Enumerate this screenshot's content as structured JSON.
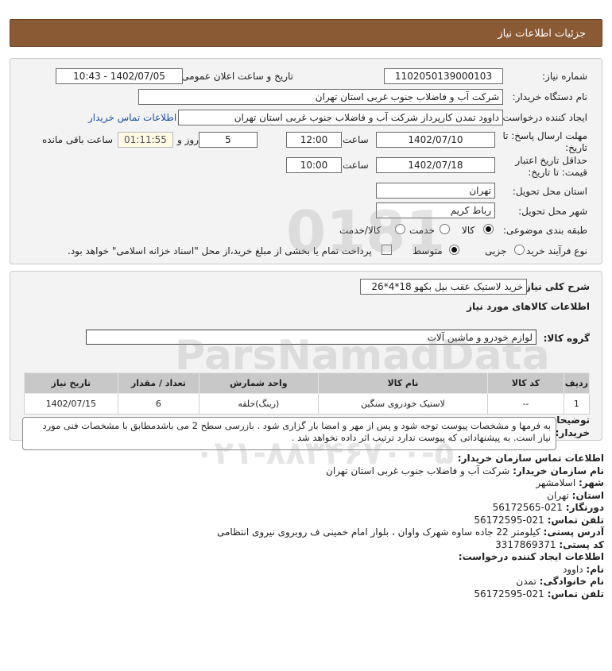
{
  "header": {
    "title": "جزئیات اطلاعات نیاز"
  },
  "form": {
    "need_number_label": "شماره نیاز:",
    "need_number": "1102050139000103",
    "announce_label": "تاریخ و ساعت اعلان عمومی:",
    "announce_value": "1402/07/05 - 10:43",
    "buyer_org_label": "نام دستگاه خریدار:",
    "buyer_org": "شرکت آب و فاضلاب جنوب غربی استان تهران",
    "creator_label": "ایجاد کننده درخواست:",
    "creator": "داوود  تمدن  کارپرداز شرکت آب و فاضلاب جنوب غربی استان تهران",
    "contact_link": "اطلاعات تماس خریدار",
    "deadline_label_1": "مهلت ارسال پاسخ: تا",
    "deadline_label_2": "تاریخ:",
    "deadline_date": "1402/07/10",
    "hour_label": "ساعت",
    "deadline_hour": "12:00",
    "days_value": "5",
    "days_label": "روز و",
    "remaining_time": "01:11:55",
    "remaining_label": "ساعت باقی مانده",
    "validity_label_1": "حداقل تاریخ اعتبار",
    "validity_label_2": "قیمت: تا تاریخ:",
    "validity_date": "1402/07/18",
    "validity_hour_label": "ساعت",
    "validity_hour": "10:00",
    "province_label": "استان محل تحویل:",
    "province": "تهران",
    "city_label": "شهر محل تحویل:",
    "city": "رباط کریم",
    "category_label": "طبقه بندی موضوعی:",
    "category_options": [
      "کالا",
      "خدمت",
      "کالا/خدمت"
    ],
    "purchase_type_label": "نوع فرآیند خرید :",
    "purchase_options": [
      "جزیی",
      "متوسط"
    ],
    "payment_note": "پرداخت تمام یا بخشی از مبلغ خرید،از محل \"اسناد خزانه اسلامی\" خواهد بود."
  },
  "items_section": {
    "summary_label": "شرح کلی نیاز:",
    "summary": "خرید لاستیک عقب بیل بکهو 18*4*26",
    "info_title": "اطلاعات کالاهای مورد نیاز",
    "group_label": "گروه کالا:",
    "group_value": "لوازم خودرو و ماشین آلات",
    "table_headers": [
      "ردیف",
      "کد کالا",
      "نام کالا",
      "واحد شمارش",
      "تعداد / مقدار",
      "تاریخ نیاز"
    ],
    "rows": [
      [
        "1",
        "--",
        "لاستیک خودروی سنگین",
        "(رینگ)حلقه",
        "6",
        "1402/07/15"
      ]
    ],
    "buyer_notes_label_1": "توضیحات",
    "buyer_notes_label_2": "خریدار:",
    "buyer_notes": "به فرمها و مشخصات پیوست توجه شود و پس از مهر و امضا بار گزاری شود . بازرسی سطح 2 می باشدمطابق با مشخصات فنی مورد نیاز است. به پیشنهاداتی که پیوست ندارد ترتیب اثر داده نخواهد شد ."
  },
  "contact": {
    "title": "اطلاعات تماس سازمان خریدار:",
    "buyer_name_label": "نام سازمان خریدار:",
    "buyer_name": "شرکت آب و فاضلاب جنوب غربی استان تهران",
    "city_label": "شهر:",
    "city": "اسلامشهر",
    "province_label": "استان:",
    "province": "تهران",
    "fax_label": "دورنگار:",
    "fax": "021-56172565",
    "phone_label": "تلفن تماس:",
    "phone": "021-56172595",
    "address_label": "آدرس پستی:",
    "address": "کیلومتر 22 جاده ساوه شهرک واوان ، بلوار امام خمینی ف روبروی نیروی انتظامی",
    "postal_label": "کد پستی:",
    "postal": "3317869371",
    "creator_title": "اطلاعات ایجاد کننده درخواست:",
    "first_name_label": "نام:",
    "first_name": "داوود",
    "last_name_label": "نام خانوادگی:",
    "last_name": "تمدن",
    "creator_phone_label": "تلفن تماس:",
    "creator_phone": "021-56172595"
  },
  "watermark": {
    "brand": "ParsNamadData",
    "number": "0181",
    "phone": "۰۲۱-۸۸۳۴۶۷۰۰-۵"
  }
}
